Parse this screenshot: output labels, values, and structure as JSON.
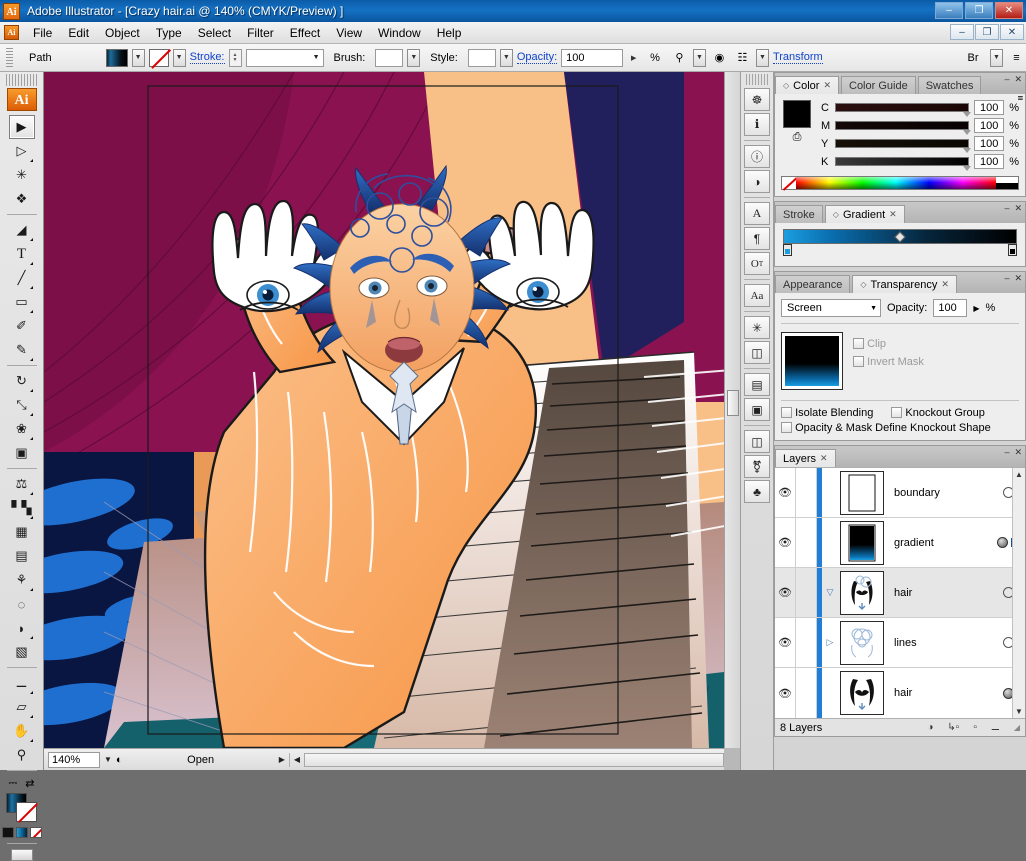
{
  "window": {
    "app_icon": "Ai",
    "title": "Adobe Illustrator - [Crazy hair.ai @ 140% (CMYK/Preview) ]",
    "minimize": "–",
    "restore": "❐",
    "close": "✕",
    "doc_minimize": "–",
    "doc_restore": "❐",
    "doc_close": "✕"
  },
  "menu": {
    "items": [
      {
        "label": "File"
      },
      {
        "label": "Edit"
      },
      {
        "label": "Object"
      },
      {
        "label": "Type"
      },
      {
        "label": "Select"
      },
      {
        "label": "Filter"
      },
      {
        "label": "Effect"
      },
      {
        "label": "View"
      },
      {
        "label": "Window"
      },
      {
        "label": "Help"
      }
    ]
  },
  "control_bar": {
    "object_label": "Path",
    "stroke_label": "Stroke:",
    "stroke_value": "",
    "brush_label": "Brush:",
    "brush_value": "",
    "style_label": "Style:",
    "style_value": "",
    "opacity_label": "Opacity:",
    "opacity_value": "100",
    "percent": "%",
    "transform_label": "Transform",
    "bridge_icon": "Br"
  },
  "toolbox": {
    "logo": "Ai",
    "tools": [
      {
        "name": "selection-tool",
        "glyph": "▶",
        "selected": true
      },
      {
        "name": "direct-selection-tool",
        "glyph": "▷",
        "selected": false
      },
      {
        "name": "magic-wand-tool",
        "glyph": "✳",
        "selected": false
      },
      {
        "name": "lasso-tool",
        "glyph": "❦",
        "selected": false
      },
      {
        "name": "pen-tool",
        "glyph": "✒",
        "selected": false
      },
      {
        "name": "type-tool",
        "glyph": "T",
        "selected": false
      },
      {
        "name": "line-segment-tool",
        "glyph": "╲",
        "selected": false
      },
      {
        "name": "rectangle-tool",
        "glyph": "■",
        "selected": false
      },
      {
        "name": "paintbrush-tool",
        "glyph": "✎",
        "selected": false
      },
      {
        "name": "pencil-tool",
        "glyph": "✏",
        "selected": false
      },
      {
        "name": "rotate-tool",
        "glyph": "↻",
        "selected": false
      },
      {
        "name": "scale-tool",
        "glyph": "⤡",
        "selected": false
      },
      {
        "name": "warp-tool",
        "glyph": "❀",
        "selected": false
      },
      {
        "name": "free-transform-tool",
        "glyph": "⬚",
        "selected": false
      },
      {
        "name": "symbol-sprayer-tool",
        "glyph": "⚘",
        "selected": false
      },
      {
        "name": "column-graph-tool",
        "glyph": "ᵛ",
        "selected": false
      },
      {
        "name": "mesh-tool",
        "glyph": "⬚",
        "selected": false
      },
      {
        "name": "gradient-tool",
        "glyph": "▤",
        "selected": false
      },
      {
        "name": "eyedropper-tool",
        "glyph": "⚗",
        "selected": false
      },
      {
        "name": "blend-tool",
        "glyph": "◌",
        "selected": false
      },
      {
        "name": "live-paint-bucket-tool",
        "glyph": "◗",
        "selected": false
      },
      {
        "name": "live-paint-selection-tool",
        "glyph": "▧",
        "selected": false
      },
      {
        "name": "slice-tool",
        "glyph": "✢",
        "selected": false
      },
      {
        "name": "eraser-tool",
        "glyph": "▱",
        "selected": false
      },
      {
        "name": "hand-tool",
        "glyph": "✋",
        "selected": false
      },
      {
        "name": "zoom-tool",
        "glyph": "⚲",
        "selected": false
      }
    ],
    "fill_stroke": {
      "swap_icon": "⇄",
      "default_icon": "⧉"
    }
  },
  "document": {
    "zoom_value": "140%",
    "status_text": "Open",
    "status_arrow": "▶"
  },
  "icon_dock": {
    "icons": [
      {
        "name": "navigator-icon",
        "glyph": "☸"
      },
      {
        "name": "info-panel-icon",
        "glyph": "ⓘ"
      },
      {
        "name": "document-info-icon",
        "glyph": "ℹ"
      },
      {
        "name": "attributes-icon",
        "glyph": "◑"
      },
      {
        "name": "character-panel-icon",
        "glyph": "A"
      },
      {
        "name": "paragraph-panel-icon",
        "glyph": "¶"
      },
      {
        "name": "opentype-panel-icon",
        "glyph": "O"
      },
      {
        "name": "character-styles-icon",
        "glyph": "Aa"
      },
      {
        "name": "magic-wand-panel-icon",
        "glyph": "✳"
      },
      {
        "name": "pathfinder-panel-icon",
        "glyph": "⧉"
      },
      {
        "name": "align-panel-icon",
        "glyph": "☰"
      },
      {
        "name": "artboards-panel-icon",
        "glyph": "⬚"
      },
      {
        "name": "symbols-panel-icon",
        "glyph": "❑"
      },
      {
        "name": "brushes-panel-icon",
        "glyph": "❀"
      },
      {
        "name": "swatches-panel-icon",
        "glyph": "♣"
      }
    ]
  },
  "color_panel": {
    "tabs": [
      {
        "label": "Color",
        "active": true,
        "closable": true
      },
      {
        "label": "Color Guide",
        "active": false,
        "closable": false
      },
      {
        "label": "Swatches",
        "active": false,
        "closable": false
      }
    ],
    "sliders": [
      {
        "label": "C",
        "value": "100",
        "unit": "%"
      },
      {
        "label": "M",
        "value": "100",
        "unit": "%"
      },
      {
        "label": "Y",
        "value": "100",
        "unit": "%"
      },
      {
        "label": "K",
        "value": "100",
        "unit": "%"
      }
    ],
    "swatch_color": "#000000",
    "collapse": "–",
    "close": "✕",
    "menu": "≡"
  },
  "gradient_panel": {
    "tabs": [
      {
        "label": "Stroke",
        "active": false,
        "closable": false
      },
      {
        "label": "Gradient",
        "active": true,
        "closable": true
      }
    ],
    "start_color": "#1a9ee0",
    "end_color": "#000000",
    "collapse": "–",
    "close": "✕",
    "menu": "≡"
  },
  "transparency_panel": {
    "tabs": [
      {
        "label": "Appearance",
        "active": false,
        "closable": false
      },
      {
        "label": "Transparency",
        "active": true,
        "closable": true
      }
    ],
    "blend_mode": "Screen",
    "blend_arrow": "▼",
    "opacity_label": "Opacity:",
    "opacity_value": "100",
    "percent": "%",
    "clip_label": "Clip",
    "invert_mask_label": "Invert Mask",
    "isolate_blending_label": "Isolate Blending",
    "knockout_group_label": "Knockout Group",
    "opacity_mask_label": "Opacity & Mask Define Knockout Shape",
    "collapse": "–",
    "close": "✕",
    "menu": "≡"
  },
  "layers_panel": {
    "tabs": [
      {
        "label": "Layers",
        "active": true,
        "closable": true
      }
    ],
    "collapse": "–",
    "close": "✕",
    "menu": "≡",
    "rows": [
      {
        "name": "boundary",
        "visible": true,
        "selected": false,
        "twisty": "",
        "target": "ring",
        "thumb": "boundary"
      },
      {
        "name": "gradient",
        "visible": true,
        "selected": false,
        "twisty": "",
        "target": "filled",
        "thumb": "gradient",
        "chip": true
      },
      {
        "name": "hair",
        "visible": true,
        "selected": true,
        "twisty": "▽",
        "target": "ring",
        "thumb": "hair"
      },
      {
        "name": "lines",
        "visible": true,
        "selected": false,
        "twisty": "▷",
        "target": "ring",
        "thumb": "lines"
      },
      {
        "name": "hair",
        "visible": true,
        "selected": false,
        "twisty": "",
        "target": "filled",
        "thumb": "hair"
      }
    ],
    "footer": {
      "count": "8 Layers",
      "make_clipping_mask": "◑",
      "create_new_sublayer": "↳",
      "create_new_layer": "⧉",
      "delete_selection": "Ὕ1"
    }
  },
  "artwork": {
    "title": "Crazy hair illustration",
    "description": "Baby with blue spiked hair and face paint raising two white hands with eyes, over a piano keyboard in perspective, magenta curtain backdrop",
    "colors": {
      "curtain": "#8a1250",
      "skin": "#f7b279",
      "coat": "#f9a45c",
      "hair_blue": "#2a57a8",
      "deep_navy": "#0a1642",
      "teal": "#15606b",
      "cyan": "#1a9ee0"
    }
  }
}
